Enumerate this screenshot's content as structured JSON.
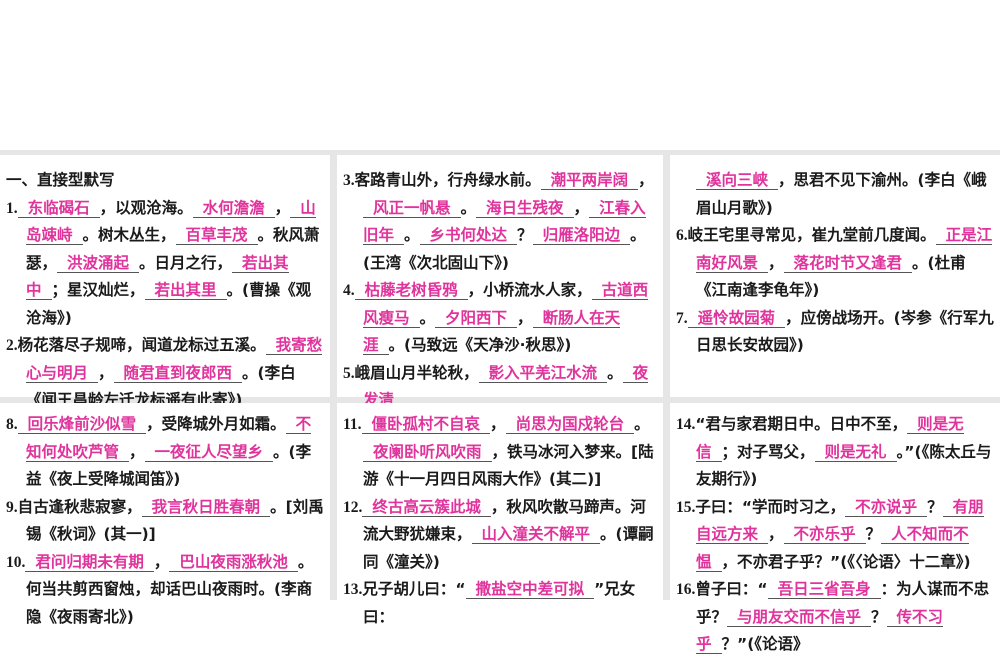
{
  "colors": {
    "answer": "#e0339c",
    "background": "#e6e6e6"
  },
  "panels": [
    {
      "heading": "一、直接型默写",
      "items": [
        {
          "num": "1.",
          "segs": [
            {
              "b": "东临碣石"
            },
            {
              "t": "，以观沧海。"
            },
            {
              "b": "水何澹澹"
            },
            {
              "t": "，"
            },
            {
              "b": "山岛竦峙"
            },
            {
              "t": "。树木丛生，"
            },
            {
              "b": "百草丰茂"
            },
            {
              "t": "。秋风萧瑟，"
            },
            {
              "b": "洪波涌起"
            },
            {
              "t": "。日月之行，"
            },
            {
              "b": "若出其中"
            },
            {
              "t": "；星汉灿烂，"
            },
            {
              "b": "若出其里"
            },
            {
              "t": "。(曹操《观沧海》)"
            }
          ]
        },
        {
          "num": "2.",
          "segs": [
            {
              "t": "杨花落尽子规啼，闻道龙标过五溪。"
            },
            {
              "b": "我寄愁心与明月"
            },
            {
              "t": "，"
            },
            {
              "b": "随君直到夜郎西"
            },
            {
              "t": "。(李白《闻王昌龄左迁龙标遥有此寄》)"
            }
          ]
        }
      ]
    },
    {
      "items": [
        {
          "num": "3.",
          "segs": [
            {
              "t": "客路青山外，行舟绿水前。"
            },
            {
              "b": "潮平两岸阔"
            },
            {
              "t": "，"
            },
            {
              "b": "风正一帆悬"
            },
            {
              "t": "。"
            },
            {
              "b": "海日生残夜"
            },
            {
              "t": "，"
            },
            {
              "b": "江春入旧年"
            },
            {
              "t": "。"
            },
            {
              "b": "乡书何处达"
            },
            {
              "t": "？"
            },
            {
              "b": "归雁洛阳边"
            },
            {
              "t": "。(王湾《次北固山下》)"
            }
          ]
        },
        {
          "num": "4.",
          "segs": [
            {
              "b": "枯藤老树昏鸦"
            },
            {
              "t": "，小桥流水人家，"
            },
            {
              "b": "古道西风瘦马"
            },
            {
              "t": "。"
            },
            {
              "b": "夕阳西下"
            },
            {
              "t": "，"
            },
            {
              "b": "断肠人在天涯"
            },
            {
              "t": "。(马致远《天净沙·秋思》)"
            }
          ]
        },
        {
          "num": "5.",
          "segs": [
            {
              "t": "峨眉山月半轮秋，"
            },
            {
              "b": "影入平羌江水流"
            },
            {
              "t": "。"
            },
            {
              "b": "夜发清"
            }
          ]
        }
      ]
    },
    {
      "items": [
        {
          "num": "",
          "cont": true,
          "segs": [
            {
              "b": "溪向三峡"
            },
            {
              "t": "，思君不见下渝州。(李白《峨眉山月歌》)"
            }
          ]
        },
        {
          "num": "6.",
          "segs": [
            {
              "t": "岐王宅里寻常见，崔九堂前几度闻。"
            },
            {
              "b": "正是江南好风景"
            },
            {
              "t": "，"
            },
            {
              "b": "落花时节又逢君"
            },
            {
              "t": "。(杜甫《江南逢李龟年》)"
            }
          ]
        },
        {
          "num": "7.",
          "segs": [
            {
              "b": "遥怜故园菊"
            },
            {
              "t": "，应傍战场开。(岑参《行军九日思长安故园》)"
            }
          ]
        }
      ]
    },
    {
      "items": [
        {
          "num": "8.",
          "segs": [
            {
              "b": "回乐烽前沙似雪"
            },
            {
              "t": "，受降城外月如霜。"
            },
            {
              "b": "不知何处吹芦管"
            },
            {
              "t": "，"
            },
            {
              "b": "一夜征人尽望乡"
            },
            {
              "t": "。(李益《夜上受降城闻笛》)"
            }
          ]
        },
        {
          "num": "9.",
          "segs": [
            {
              "t": "自古逢秋悲寂寥，"
            },
            {
              "b": "我言秋日胜春朝"
            },
            {
              "t": "。[刘禹锡《秋词》(其一)]"
            }
          ]
        },
        {
          "num": "10.",
          "segs": [
            {
              "b": "君问归期未有期"
            },
            {
              "t": "，"
            },
            {
              "b": "巴山夜雨涨秋池"
            },
            {
              "t": "。何当共剪西窗烛，却话巴山夜雨时。(李商隐《夜雨寄北》)"
            }
          ]
        }
      ]
    },
    {
      "items": [
        {
          "num": "11.",
          "segs": [
            {
              "b": "僵卧孤村不自哀"
            },
            {
              "t": "，"
            },
            {
              "b": "尚思为国戍轮台"
            },
            {
              "t": "。"
            },
            {
              "b": "夜阑卧听风吹雨"
            },
            {
              "t": "，铁马冰河入梦来。[陆游《十一月四日风雨大作》(其二)]"
            }
          ]
        },
        {
          "num": "12.",
          "segs": [
            {
              "b": "终古高云簇此城"
            },
            {
              "t": "，秋风吹散马蹄声。河流大野犹嫌束，"
            },
            {
              "b": "山入潼关不解平"
            },
            {
              "t": "。(谭嗣同《潼关》)"
            }
          ]
        },
        {
          "num": "13.",
          "segs": [
            {
              "t": "兄子胡儿曰：“"
            },
            {
              "b": "撒盐空中差可拟"
            },
            {
              "t": "”兄女曰："
            }
          ]
        }
      ]
    },
    {
      "items": [
        {
          "num": "14.",
          "segs": [
            {
              "t": "“君与家君期日中。日中不至，"
            },
            {
              "b": "则是无信"
            },
            {
              "t": "；对子骂父，"
            },
            {
              "b": "则是无礼"
            },
            {
              "t": "。”(《陈太丘与友期行》)"
            }
          ]
        },
        {
          "num": "15.",
          "segs": [
            {
              "t": "子曰：“学而时习之，"
            },
            {
              "b": "不亦说乎"
            },
            {
              "t": "？"
            },
            {
              "b": "有朋自远方来"
            },
            {
              "t": "，"
            },
            {
              "b": "不亦乐乎"
            },
            {
              "t": "？"
            },
            {
              "b": "人不知而不愠"
            },
            {
              "t": "，不亦君子乎？”(《〈论语〉十二章》)"
            }
          ]
        },
        {
          "num": "16.",
          "segs": [
            {
              "t": "曾子曰：“"
            },
            {
              "b": "吾日三省吾身"
            },
            {
              "t": "：为人谋而不忠乎？"
            },
            {
              "b": "与朋友交而不信乎"
            },
            {
              "t": "？"
            },
            {
              "b": "传不习乎"
            },
            {
              "t": "？”(《论语》"
            }
          ]
        }
      ]
    }
  ]
}
